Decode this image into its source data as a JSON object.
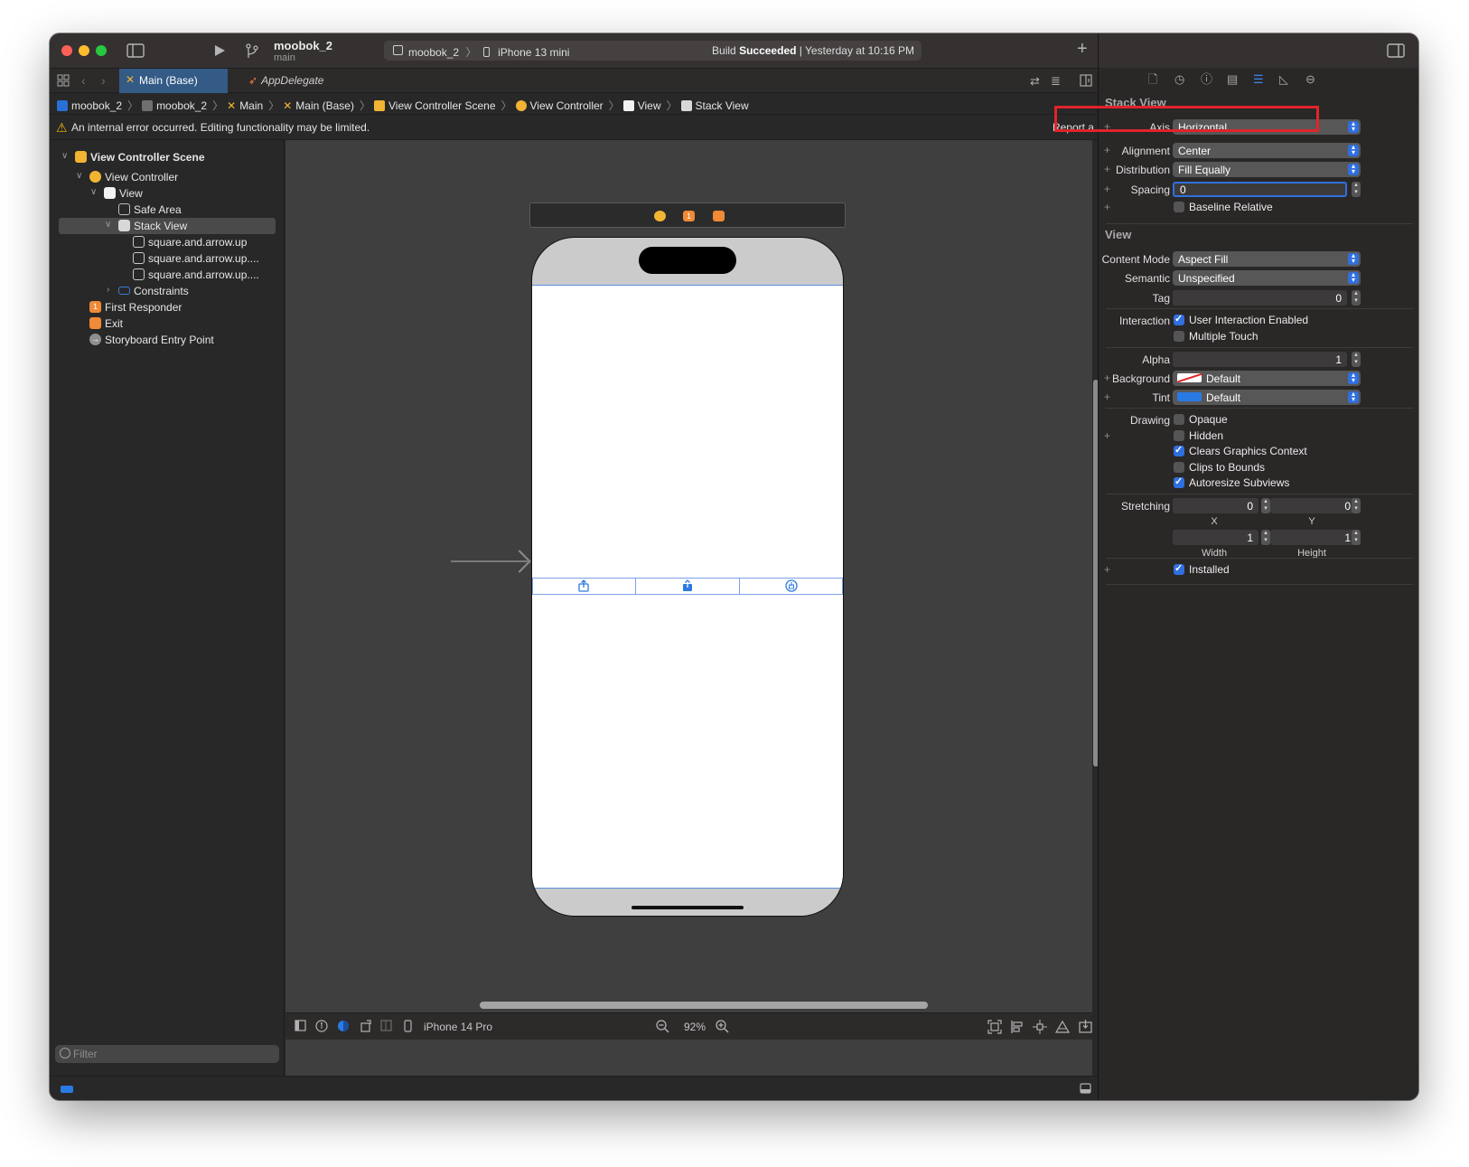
{
  "toolbar": {
    "project_name": "moobok_2",
    "branch": "main",
    "scheme": "moobok_2",
    "device": "iPhone 13 mini",
    "status_prefix": "Build",
    "status_bold": "Succeeded",
    "status_suffix": "| Yesterday at 10:16 PM"
  },
  "tabs": {
    "active": "Main (Base)",
    "second": "AppDelegate"
  },
  "breadcrumb": {
    "items": [
      "moobok_2",
      "moobok_2",
      "Main",
      "Main (Base)",
      "View Controller Scene",
      "View Controller",
      "View",
      "Stack View"
    ]
  },
  "warning": {
    "text": "An internal error occurred. Editing functionality may be limited.",
    "report": "Report a Bug"
  },
  "navigator": {
    "items": [
      {
        "label": "View Controller Scene"
      },
      {
        "label": "View Controller"
      },
      {
        "label": "View"
      },
      {
        "label": "Safe Area"
      },
      {
        "label": "Stack View"
      },
      {
        "label": "square.and.arrow.up"
      },
      {
        "label": "square.and.arrow.up...."
      },
      {
        "label": "square.and.arrow.up...."
      },
      {
        "label": "Constraints"
      },
      {
        "label": "First Responder"
      },
      {
        "label": "Exit"
      },
      {
        "label": "Storyboard Entry Point"
      }
    ],
    "filter_placeholder": "Filter"
  },
  "canvas": {
    "device_label": "iPhone 14 Pro",
    "zoom": "92%",
    "responder_badge": "1"
  },
  "inspector": {
    "stack_view": {
      "title": "Stack View",
      "axis_label": "Axis",
      "axis_value": "Horizontal",
      "alignment_label": "Alignment",
      "alignment_value": "Center",
      "distribution_label": "Distribution",
      "distribution_value": "Fill Equally",
      "spacing_label": "Spacing",
      "spacing_value": "0",
      "baseline_label": "Baseline Relative"
    },
    "view": {
      "title": "View",
      "content_mode_label": "Content Mode",
      "content_mode_value": "Aspect Fill",
      "semantic_label": "Semantic",
      "semantic_value": "Unspecified",
      "tag_label": "Tag",
      "tag_value": "0",
      "interaction_label": "Interaction",
      "user_interaction_label": "User Interaction Enabled",
      "multiple_touch_label": "Multiple Touch",
      "alpha_label": "Alpha",
      "alpha_value": "1",
      "background_label": "Background",
      "background_value": "Default",
      "tint_label": "Tint",
      "tint_value": "Default",
      "drawing_label": "Drawing",
      "opaque_label": "Opaque",
      "hidden_label": "Hidden",
      "clears_label": "Clears Graphics Context",
      "clips_label": "Clips to Bounds",
      "autoresize_label": "Autoresize Subviews",
      "stretching_label": "Stretching",
      "stretch_x": "0",
      "stretch_y": "0",
      "stretch_w": "1",
      "stretch_h": "1",
      "x_label": "X",
      "y_label": "Y",
      "width_label": "Width",
      "height_label": "Height",
      "installed_label": "Installed"
    }
  },
  "colors": {
    "accent": "#2f6fe0",
    "highlight": "#e0242a",
    "warning": "#f4b400"
  }
}
